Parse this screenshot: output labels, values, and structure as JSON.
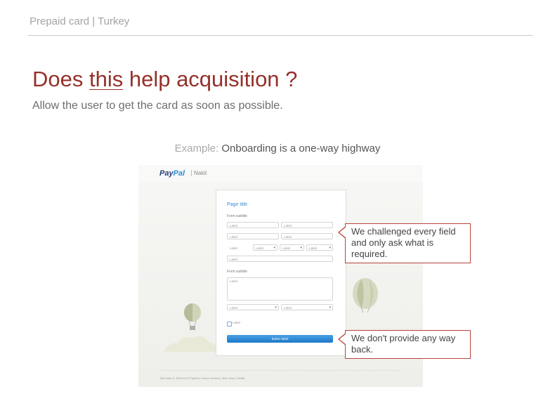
{
  "header": {
    "label": "Prepaid card | Turkey"
  },
  "title": {
    "before": "Does ",
    "underlined": "this",
    "after": " help acquisition ?"
  },
  "subtitle": "Allow the user to get the card as soon as possible.",
  "example": {
    "prefix": "Example:",
    "text": "Onboarding is a one-way highway"
  },
  "mock": {
    "logo_pay": "Pay",
    "logo_pal": "Pal",
    "logo_sub": "Nakit",
    "page_title": "Page title",
    "form_subtitle_1": "Form subtitle",
    "form_subtitle_2": "Form subtitle",
    "field_label": "Label",
    "checkbox_label": "Label",
    "button_label": "Button label",
    "footer": "Telif hakkı © 1999-2013 PayPal  |  Yasom Merkezi  |  Bize Ulaş  |  Gizlilik"
  },
  "callouts": {
    "first": "We challenged every field and only ask what is required.",
    "second": "We don't provide any way back."
  },
  "colors": {
    "accent": "#95312b",
    "callout_border": "#b8433b",
    "paypal_blue": "#273d79",
    "button_blue": "#1d78c7"
  }
}
